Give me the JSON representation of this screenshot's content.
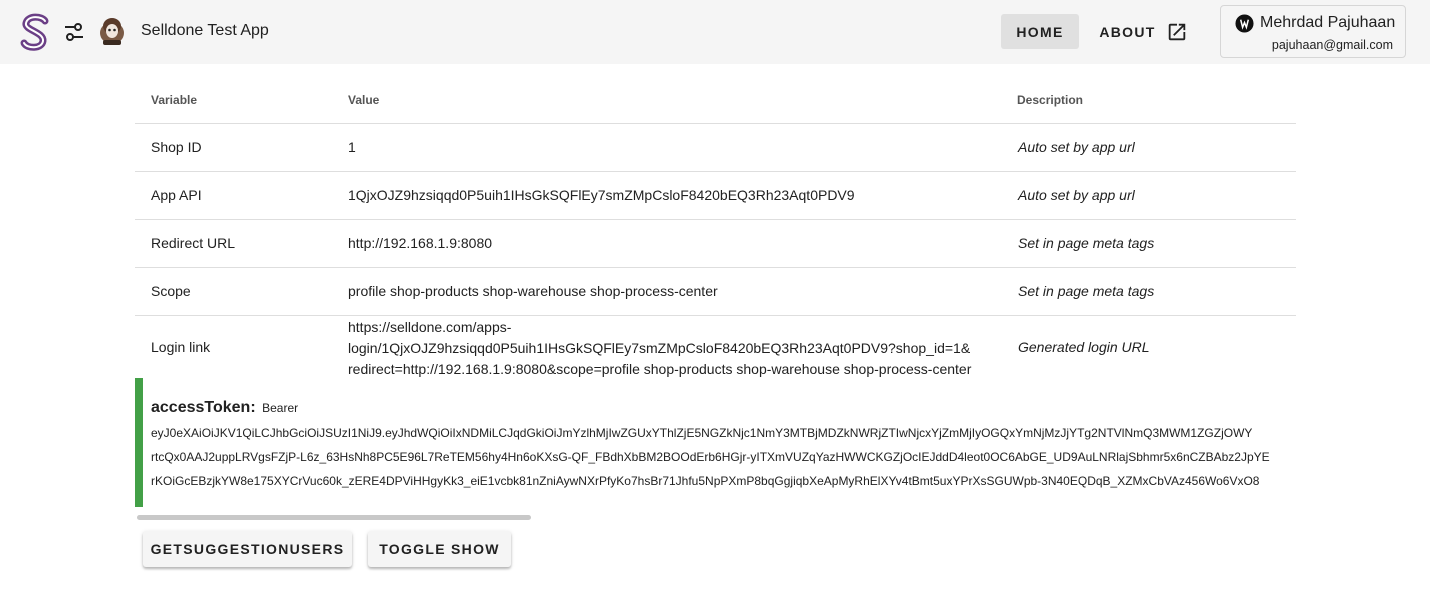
{
  "header": {
    "app_title": "Selldone Test App",
    "nav": {
      "home": "HOME",
      "about": "ABOUT"
    },
    "user": {
      "name": "Mehrdad Pajuhaan",
      "email": "pajuhaan@gmail.com"
    },
    "colors": {
      "logo": "#6b3f86",
      "bar": "#f5f5f5"
    }
  },
  "table": {
    "headers": {
      "variable": "Variable",
      "value": "Value",
      "description": "Description"
    },
    "rows": [
      {
        "variable": "Shop ID",
        "value": "1",
        "description": "Auto set by app url"
      },
      {
        "variable": "App API",
        "value": "1QjxOJZ9hzsiqqd0P5uih1IHsGkSQFlEy7smZMpCsloF8420bEQ3Rh23Aqt0PDV9",
        "description": "Auto set by app url"
      },
      {
        "variable": "Redirect URL",
        "value": "http://192.168.1.9:8080",
        "description": "Set in page meta tags"
      },
      {
        "variable": "Scope",
        "value": "profile shop-products shop-warehouse shop-process-center",
        "description": "Set in page meta tags"
      },
      {
        "variable": "Login link",
        "value_lines": [
          "https://selldone.com/apps-",
          "login/1QjxOJZ9hzsiqqd0P5uih1IHsGkSQFlEy7smZMpCsloF8420bEQ3Rh23Aqt0PDV9?shop_id=1&",
          "redirect=http://192.168.1.9:8080&scope=profile shop-products shop-warehouse shop-process-center"
        ],
        "description": "Generated login URL"
      }
    ]
  },
  "token": {
    "key": "accessToken:",
    "type": "Bearer",
    "lines": [
      "eyJ0eXAiOiJKV1QiLCJhbGciOiJSUzI1NiJ9.eyJhdWQiOiIxNDMiLCJqdGkiOiJmYzlhMjIwZGUxYThlZjE5NGZkNjc1NmY3MTBjMDZkNWRjZTIwNjcxYjZmMjIyOGQxYmNjMzJjYTg2NTVlNmQ3MWM1ZGZjOWY",
      "rtcQx0AAJ2uppLRVgsFZjP-L6z_63HsNh8PC5E96L7ReTEM56hy4Hn6oKXsG-QF_FBdhXbBM2BOOdErb6HGjr-yITXmVUZqYazHWWCKGZjOcIEJddD4leot0OC6AbGE_UD9AuLNRlajSbhmr5x6nCZBAbz2JpYE",
      "rKOiGcEBzjkYW8e175XYCrVuc60k_zERE4DPViHHgyKk3_eiE1vcbk81nZniAywNXrPfyKo7hsBr71Jhfu5NpPXmP8bqGgjiqbXeApMyRhElXYv4tBmt5uxYPrXsSGUWpb-3N40EQDqB_XZMxCbVAz456Wo6VxO8"
    ],
    "accent_color": "#43a047"
  },
  "actions": {
    "suggestions": "GETSUGGESTIONUSERS",
    "toggle": "TOGGLE SHOW"
  }
}
